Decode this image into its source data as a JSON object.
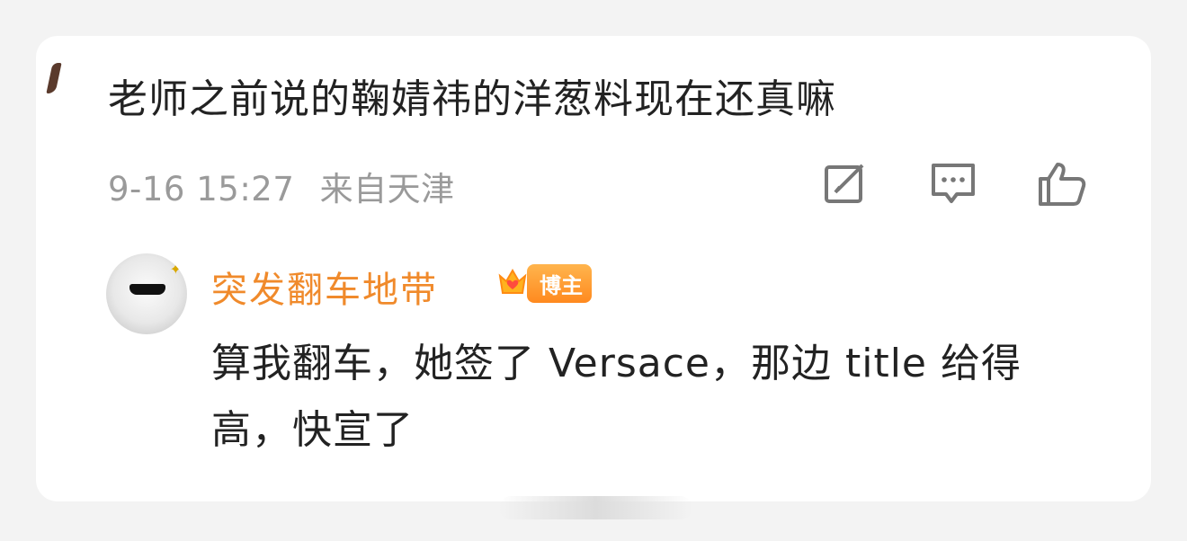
{
  "comment": {
    "text": "老师之前说的鞠婧祎的洋葱料现在还真嘛",
    "time": "9-16 15:27",
    "location": "来自天津",
    "actions": {
      "share_icon": "edit-share-icon",
      "reply_icon": "comment-bubble-icon",
      "like_icon": "thumbs-up-icon"
    }
  },
  "reply": {
    "author": "突发翻车地带",
    "badge_label": "博主",
    "text": "算我翻车，她签了 Versace，那边 title 给得高，快宣了",
    "avatar_icon": "bear-sunglasses-avatar"
  },
  "colors": {
    "author": "#f08a2b",
    "badge": "#ff8a1f",
    "meta": "#9a9a9a",
    "text": "#222222"
  }
}
